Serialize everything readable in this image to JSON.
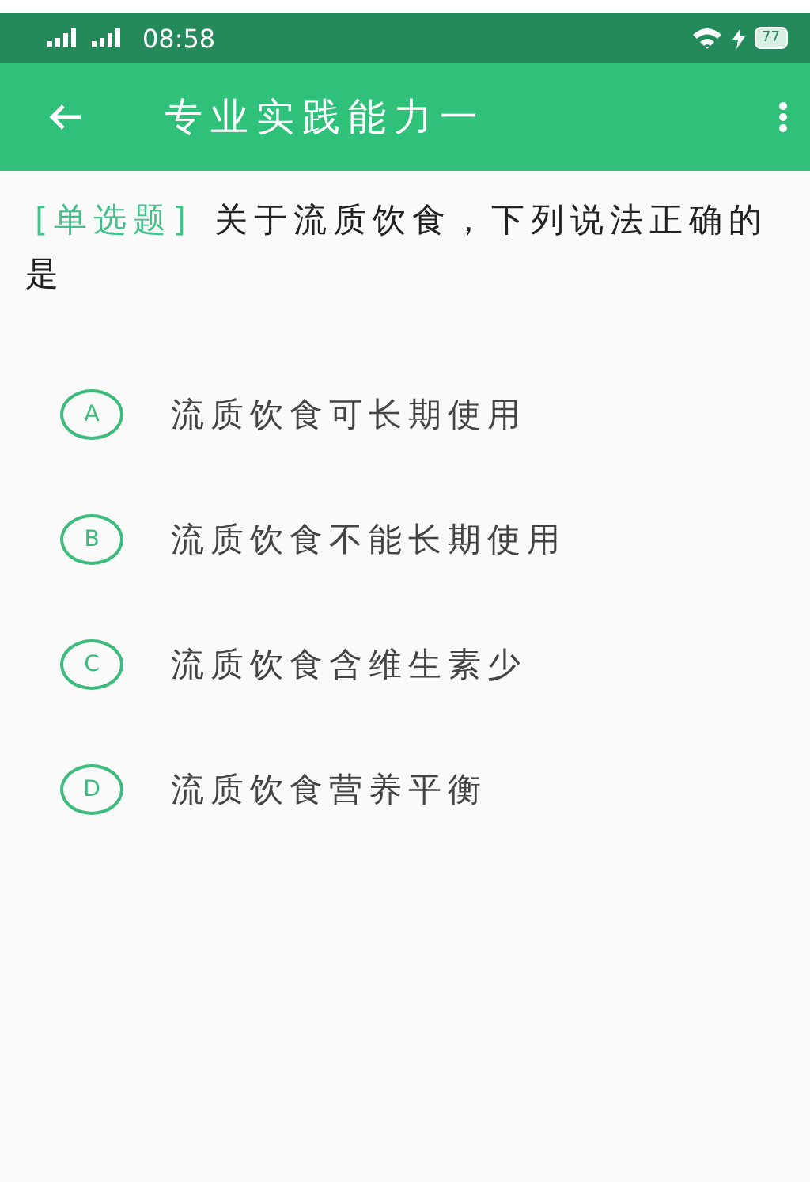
{
  "status_bar": {
    "time": "08:58",
    "battery": "77"
  },
  "app_bar": {
    "title": "专业实践能力一"
  },
  "question": {
    "type_label": "[单选题]",
    "text": "关于流质饮食，下列说法正确的是"
  },
  "options": [
    {
      "letter": "A",
      "text": "流质饮食可长期使用",
      "selected": false
    },
    {
      "letter": "B",
      "text": "流质饮食不能长期使用",
      "selected": false
    },
    {
      "letter": "C",
      "text": "流质饮食含维生素少",
      "selected": false
    },
    {
      "letter": "D",
      "text": "流质饮食营养平衡",
      "selected": false
    }
  ]
}
